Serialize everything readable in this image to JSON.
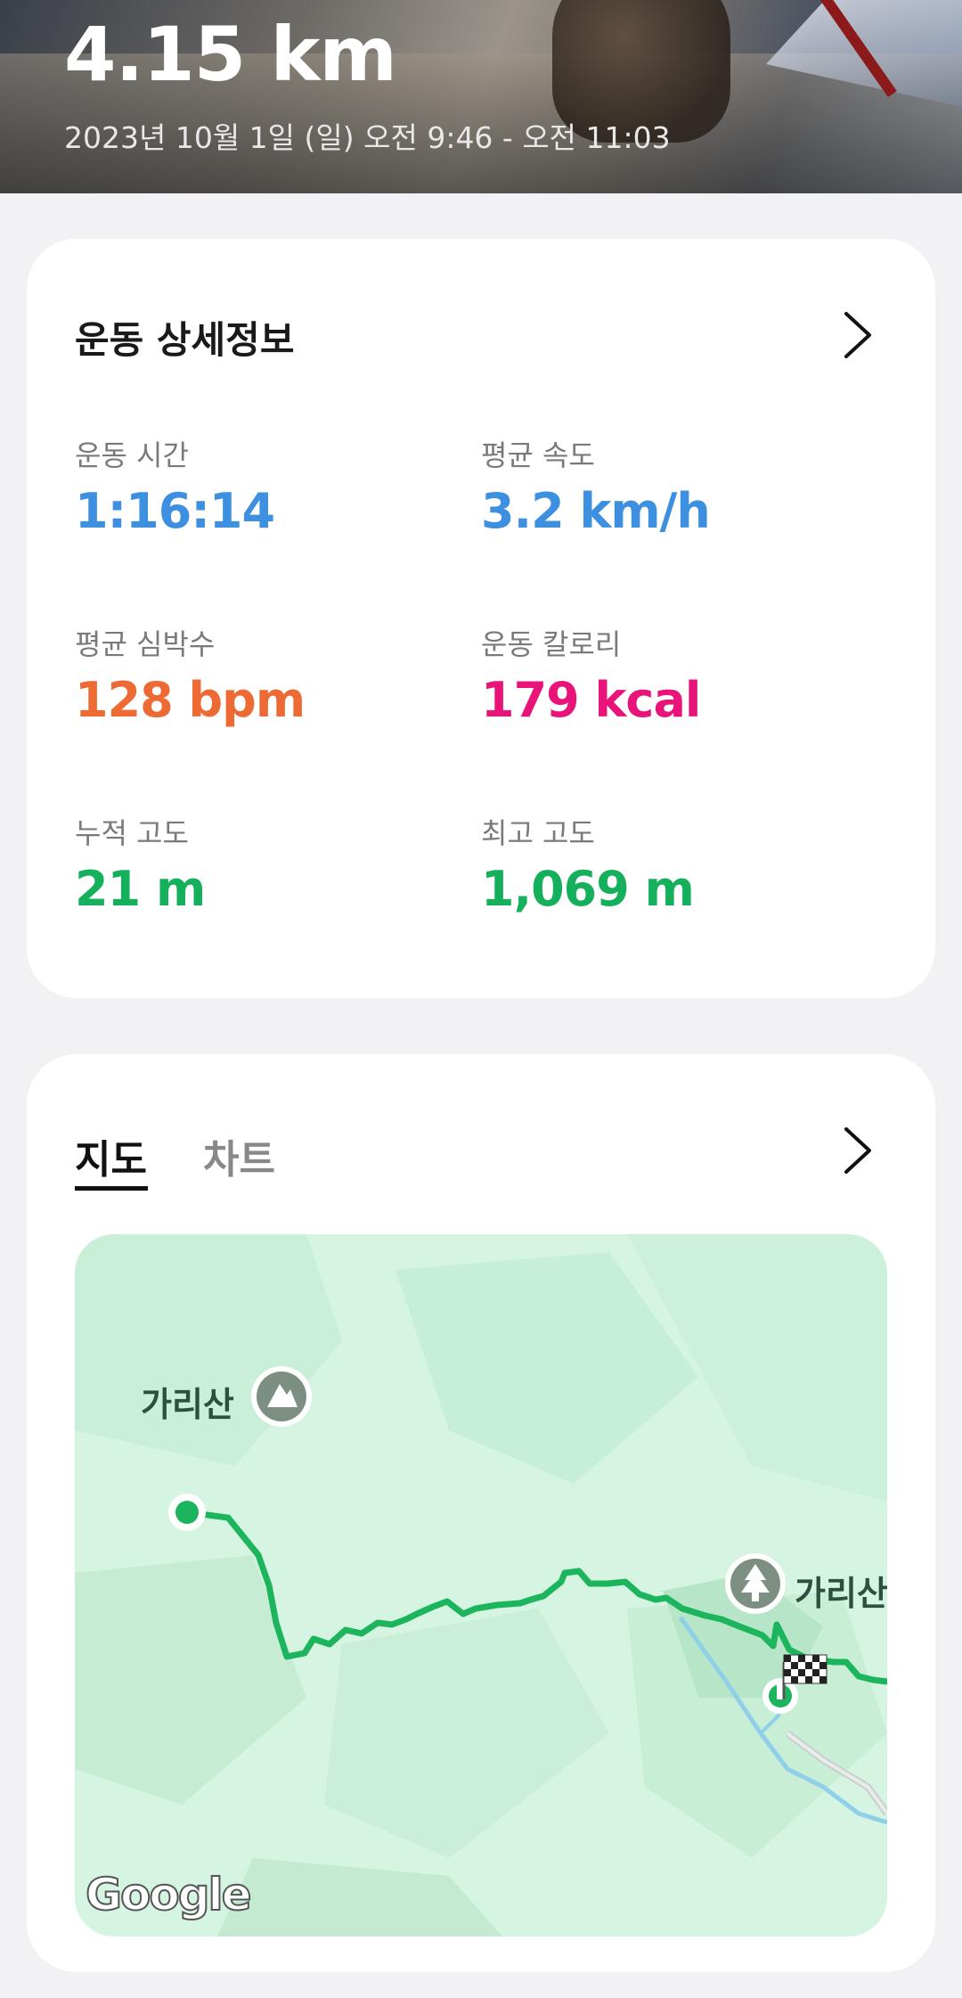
{
  "header": {
    "distance": "4.15 km",
    "date_range": "2023년 10월 1일 (일) 오전 9:46 - 오전 11:03"
  },
  "details": {
    "title": "운동 상세정보",
    "stats": [
      {
        "label": "운동 시간",
        "value": "1:16:14",
        "color": "#3d8fe0"
      },
      {
        "label": "평균 속도",
        "value": "3.2 km/h",
        "color": "#3d8fe0"
      },
      {
        "label": "평균 심박수",
        "value": "128 bpm",
        "color": "#ee6a35"
      },
      {
        "label": "운동 칼로리",
        "value": "179 kcal",
        "color": "#e8147a"
      },
      {
        "label": "누적 고도",
        "value": "21 m",
        "color": "#14b05c"
      },
      {
        "label": "최고 고도",
        "value": "1,069 m",
        "color": "#14b05c"
      }
    ]
  },
  "map_section": {
    "tabs": [
      {
        "label": "지도",
        "active": true
      },
      {
        "label": "차트",
        "active": false
      }
    ],
    "map": {
      "peak_label": "가리산",
      "forest_label": "가리산",
      "attribution": "Google",
      "route_color": "#1cb45c",
      "icons": [
        "mountain-icon",
        "tree-icon",
        "finish-flag-icon",
        "start-marker",
        "end-marker"
      ]
    }
  },
  "colors": {
    "background": "#f2f2f4",
    "card": "#ffffff",
    "blue": "#3d8fe0",
    "orange": "#ee6a35",
    "pink": "#e8147a",
    "green": "#14b05c"
  }
}
